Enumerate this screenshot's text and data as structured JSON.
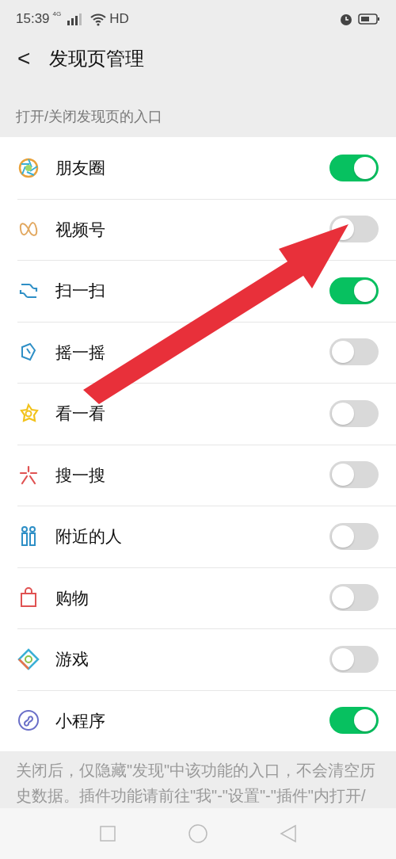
{
  "status_bar": {
    "time": "15:39",
    "network": "4G",
    "hd": "HD"
  },
  "header": {
    "back": "<",
    "title": "发现页管理"
  },
  "section_label": "打开/关闭发现页的入口",
  "items": [
    {
      "label": "朋友圈",
      "on": true
    },
    {
      "label": "视频号",
      "on": false
    },
    {
      "label": "扫一扫",
      "on": true
    },
    {
      "label": "摇一摇",
      "on": false
    },
    {
      "label": "看一看",
      "on": false
    },
    {
      "label": "搜一搜",
      "on": false
    },
    {
      "label": "附近的人",
      "on": false
    },
    {
      "label": "购物",
      "on": false
    },
    {
      "label": "游戏",
      "on": false
    },
    {
      "label": "小程序",
      "on": true
    }
  ],
  "footer_note": "关闭后，仅隐藏\"发现\"中该功能的入口，不会清空历史数据。插件功能请前往\"我\"-\"设置\"-\"插件\"内打开/",
  "annotation": {
    "kind": "arrow"
  }
}
